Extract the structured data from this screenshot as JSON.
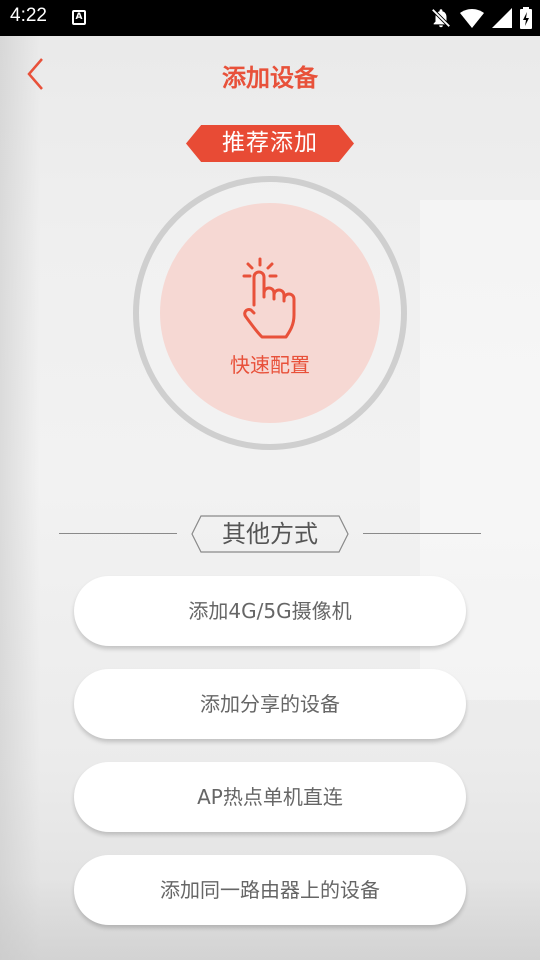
{
  "status_bar": {
    "time": "4:22"
  },
  "header": {
    "title": "添加设备"
  },
  "recommended": {
    "tag_label": "推荐添加",
    "quick_config_label": "快速配置"
  },
  "other": {
    "section_label": "其他方式",
    "options": [
      {
        "label": "添加4G/5G摄像机"
      },
      {
        "label": "添加分享的设备"
      },
      {
        "label": "AP热点单机直连"
      },
      {
        "label": "添加同一路由器上的设备"
      }
    ]
  },
  "colors": {
    "accent": "#e8513a",
    "tag_bg": "#e84b35",
    "quick_bg": "#f6d8d3"
  },
  "icons": [
    "back-chevron-icon",
    "tap-finger-icon",
    "notifications-off-icon",
    "wifi-icon",
    "cell-signal-icon",
    "battery-charging-icon"
  ]
}
